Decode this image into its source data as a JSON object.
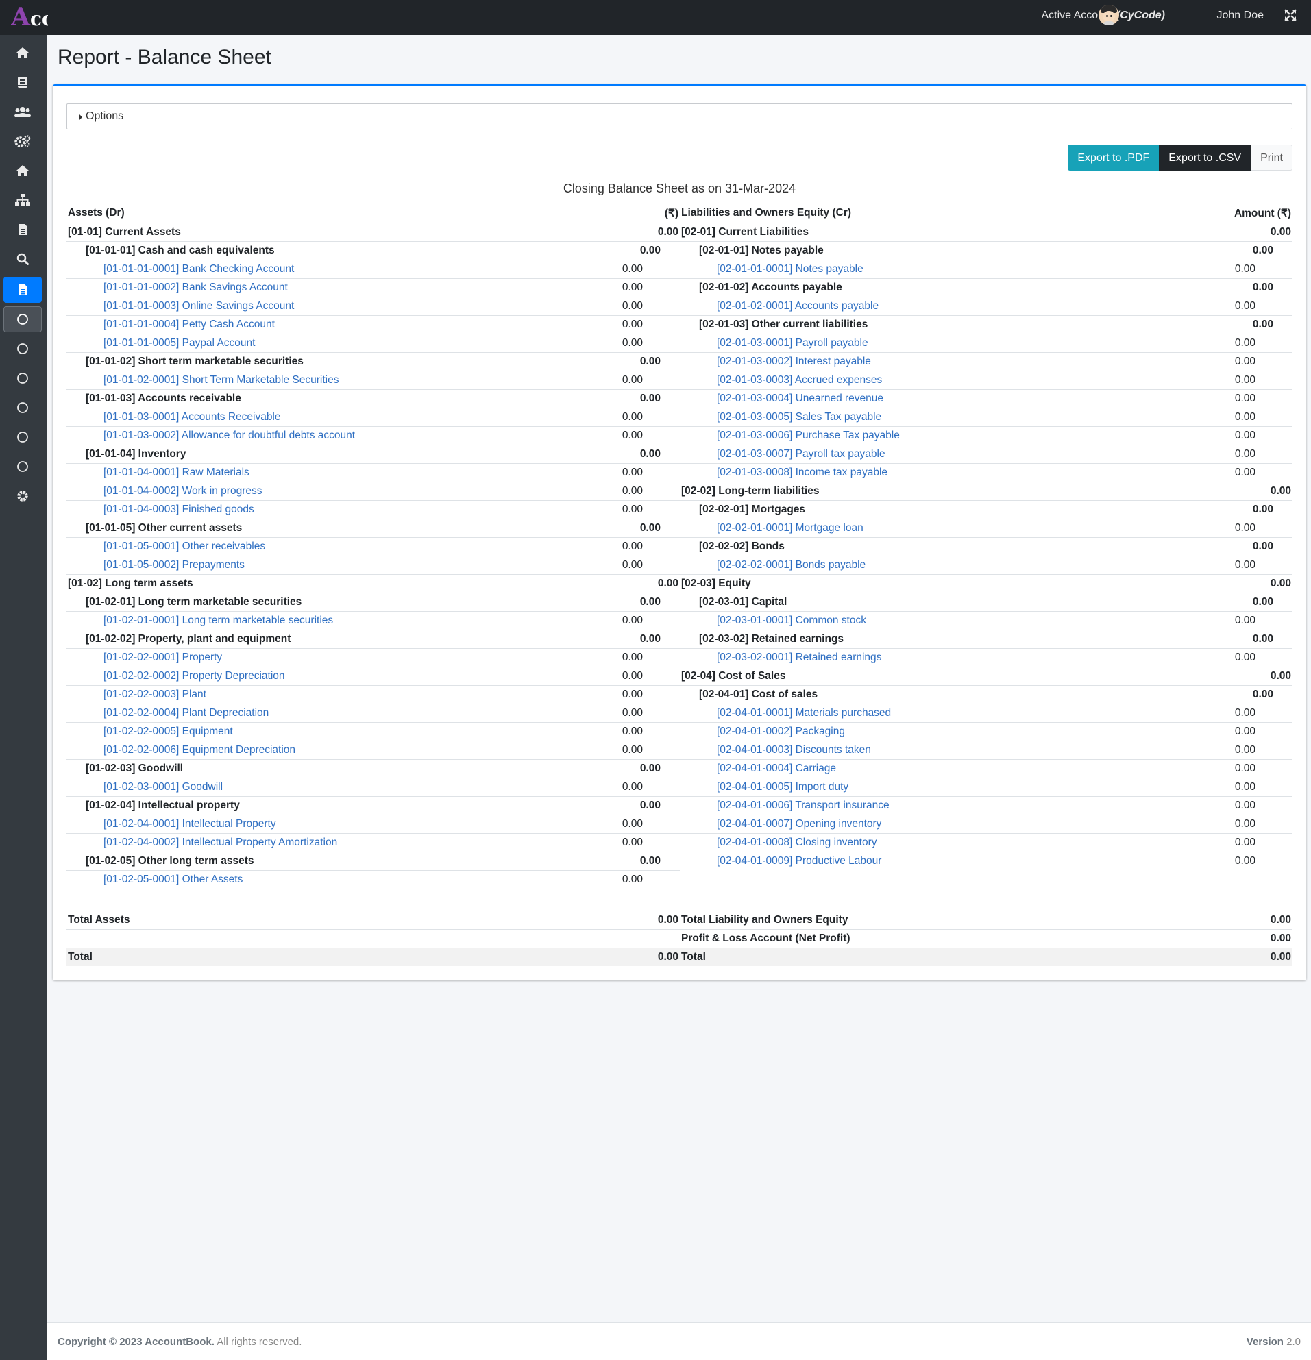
{
  "topbar": {
    "logo_initial": "A",
    "logo_rest": "cc",
    "active_account_label": "Active Account",
    "active_account_code": "(CyCode)",
    "user_name": "John Doe"
  },
  "sidebar": {
    "active_color": "#007bff",
    "items": [
      {
        "icon": "home-icon"
      },
      {
        "icon": "book-icon"
      },
      {
        "icon": "users-icon"
      },
      {
        "icon": "gears-icon"
      },
      {
        "icon": "home-icon"
      },
      {
        "icon": "sitemap-icon"
      },
      {
        "icon": "document-icon"
      },
      {
        "icon": "search-icon"
      },
      {
        "icon": "report-icon",
        "state": "active"
      },
      {
        "icon": "circle-icon",
        "state": "open"
      },
      {
        "icon": "circle-icon"
      },
      {
        "icon": "circle-icon"
      },
      {
        "icon": "circle-icon"
      },
      {
        "icon": "circle-icon"
      },
      {
        "icon": "circle-icon"
      },
      {
        "icon": "gear-icon"
      }
    ]
  },
  "page": {
    "title": "Report - Balance Sheet"
  },
  "options": {
    "label": "Options"
  },
  "buttons": {
    "pdf": "Export to .PDF",
    "csv": "Export to .CSV",
    "print": "Print"
  },
  "report": {
    "title": "Closing Balance Sheet as on 31-Mar-2024",
    "headers": {
      "assets": "Assets (Dr)",
      "assets_amount": "(₹)",
      "liabilities": "Liabilities and Owners Equity (Cr)",
      "liabilities_amount": "Amount (₹)"
    },
    "rows": [
      [
        {
          "name": "[01-01] Current Assets",
          "amount": "0.00",
          "level": 0
        },
        {
          "name": "[02-01] Current Liabilities",
          "amount": "0.00",
          "level": 0
        }
      ],
      [
        {
          "name": "[01-01-01] Cash and cash equivalents",
          "amount": "0.00",
          "level": 1
        },
        {
          "name": "[02-01-01] Notes payable",
          "amount": "0.00",
          "level": 1
        }
      ],
      [
        {
          "name": "[01-01-01-0001] Bank Checking Account",
          "amount": "0.00",
          "level": 2
        },
        {
          "name": "[02-01-01-0001] Notes payable",
          "amount": "0.00",
          "level": 2
        }
      ],
      [
        {
          "name": "[01-01-01-0002] Bank Savings Account",
          "amount": "0.00",
          "level": 2
        },
        {
          "name": "[02-01-02] Accounts payable",
          "amount": "0.00",
          "level": 1
        }
      ],
      [
        {
          "name": "[01-01-01-0003] Online Savings Account",
          "amount": "0.00",
          "level": 2
        },
        {
          "name": "[02-01-02-0001] Accounts payable",
          "amount": "0.00",
          "level": 2
        }
      ],
      [
        {
          "name": "[01-01-01-0004] Petty Cash Account",
          "amount": "0.00",
          "level": 2
        },
        {
          "name": "[02-01-03] Other current liabilities",
          "amount": "0.00",
          "level": 1
        }
      ],
      [
        {
          "name": "[01-01-01-0005] Paypal Account",
          "amount": "0.00",
          "level": 2
        },
        {
          "name": "[02-01-03-0001] Payroll payable",
          "amount": "0.00",
          "level": 2
        }
      ],
      [
        {
          "name": "[01-01-02] Short term marketable securities",
          "amount": "0.00",
          "level": 1
        },
        {
          "name": "[02-01-03-0002] Interest payable",
          "amount": "0.00",
          "level": 2
        }
      ],
      [
        {
          "name": "[01-01-02-0001] Short Term Marketable Securities",
          "amount": "0.00",
          "level": 2
        },
        {
          "name": "[02-01-03-0003] Accrued expenses",
          "amount": "0.00",
          "level": 2
        }
      ],
      [
        {
          "name": "[01-01-03] Accounts receivable",
          "amount": "0.00",
          "level": 1
        },
        {
          "name": "[02-01-03-0004] Unearned revenue",
          "amount": "0.00",
          "level": 2
        }
      ],
      [
        {
          "name": "[01-01-03-0001] Accounts Receivable",
          "amount": "0.00",
          "level": 2
        },
        {
          "name": "[02-01-03-0005] Sales Tax payable",
          "amount": "0.00",
          "level": 2
        }
      ],
      [
        {
          "name": "[01-01-03-0002] Allowance for doubtful debts account",
          "amount": "0.00",
          "level": 2
        },
        {
          "name": "[02-01-03-0006] Purchase Tax payable",
          "amount": "0.00",
          "level": 2
        }
      ],
      [
        {
          "name": "[01-01-04] Inventory",
          "amount": "0.00",
          "level": 1
        },
        {
          "name": "[02-01-03-0007] Payroll tax payable",
          "amount": "0.00",
          "level": 2
        }
      ],
      [
        {
          "name": "[01-01-04-0001] Raw Materials",
          "amount": "0.00",
          "level": 2
        },
        {
          "name": "[02-01-03-0008] Income tax payable",
          "amount": "0.00",
          "level": 2
        }
      ],
      [
        {
          "name": "[01-01-04-0002] Work in progress",
          "amount": "0.00",
          "level": 2
        },
        {
          "name": "[02-02] Long-term liabilities",
          "amount": "0.00",
          "level": 0
        }
      ],
      [
        {
          "name": "[01-01-04-0003] Finished goods",
          "amount": "0.00",
          "level": 2
        },
        {
          "name": "[02-02-01] Mortgages",
          "amount": "0.00",
          "level": 1
        }
      ],
      [
        {
          "name": "[01-01-05] Other current assets",
          "amount": "0.00",
          "level": 1
        },
        {
          "name": "[02-02-01-0001] Mortgage loan",
          "amount": "0.00",
          "level": 2
        }
      ],
      [
        {
          "name": "[01-01-05-0001] Other receivables",
          "amount": "0.00",
          "level": 2
        },
        {
          "name": "[02-02-02] Bonds",
          "amount": "0.00",
          "level": 1
        }
      ],
      [
        {
          "name": "[01-01-05-0002] Prepayments",
          "amount": "0.00",
          "level": 2
        },
        {
          "name": "[02-02-02-0001] Bonds payable",
          "amount": "0.00",
          "level": 2
        }
      ],
      [
        {
          "name": "[01-02] Long term assets",
          "amount": "0.00",
          "level": 0
        },
        {
          "name": "[02-03] Equity",
          "amount": "0.00",
          "level": 0
        }
      ],
      [
        {
          "name": "[01-02-01] Long term marketable securities",
          "amount": "0.00",
          "level": 1
        },
        {
          "name": "[02-03-01] Capital",
          "amount": "0.00",
          "level": 1
        }
      ],
      [
        {
          "name": "[01-02-01-0001] Long term marketable securities",
          "amount": "0.00",
          "level": 2
        },
        {
          "name": "[02-03-01-0001] Common stock",
          "amount": "0.00",
          "level": 2
        }
      ],
      [
        {
          "name": "[01-02-02] Property, plant and equipment",
          "amount": "0.00",
          "level": 1
        },
        {
          "name": "[02-03-02] Retained earnings",
          "amount": "0.00",
          "level": 1
        }
      ],
      [
        {
          "name": "[01-02-02-0001] Property",
          "amount": "0.00",
          "level": 2
        },
        {
          "name": "[02-03-02-0001] Retained earnings",
          "amount": "0.00",
          "level": 2
        }
      ],
      [
        {
          "name": "[01-02-02-0002] Property Depreciation",
          "amount": "0.00",
          "level": 2
        },
        {
          "name": "[02-04] Cost of Sales",
          "amount": "0.00",
          "level": 0
        }
      ],
      [
        {
          "name": "[01-02-02-0003] Plant",
          "amount": "0.00",
          "level": 2
        },
        {
          "name": "[02-04-01] Cost of sales",
          "amount": "0.00",
          "level": 1
        }
      ],
      [
        {
          "name": "[01-02-02-0004] Plant Depreciation",
          "amount": "0.00",
          "level": 2
        },
        {
          "name": "[02-04-01-0001] Materials purchased",
          "amount": "0.00",
          "level": 2
        }
      ],
      [
        {
          "name": "[01-02-02-0005] Equipment",
          "amount": "0.00",
          "level": 2
        },
        {
          "name": "[02-04-01-0002] Packaging",
          "amount": "0.00",
          "level": 2
        }
      ],
      [
        {
          "name": "[01-02-02-0006] Equipment Depreciation",
          "amount": "0.00",
          "level": 2
        },
        {
          "name": "[02-04-01-0003] Discounts taken",
          "amount": "0.00",
          "level": 2
        }
      ],
      [
        {
          "name": "[01-02-03] Goodwill",
          "amount": "0.00",
          "level": 1
        },
        {
          "name": "[02-04-01-0004] Carriage",
          "amount": "0.00",
          "level": 2
        }
      ],
      [
        {
          "name": "[01-02-03-0001] Goodwill",
          "amount": "0.00",
          "level": 2
        },
        {
          "name": "[02-04-01-0005] Import duty",
          "amount": "0.00",
          "level": 2
        }
      ],
      [
        {
          "name": "[01-02-04] Intellectual property",
          "amount": "0.00",
          "level": 1
        },
        {
          "name": "[02-04-01-0006] Transport insurance",
          "amount": "0.00",
          "level": 2
        }
      ],
      [
        {
          "name": "[01-02-04-0001] Intellectual Property",
          "amount": "0.00",
          "level": 2
        },
        {
          "name": "[02-04-01-0007] Opening inventory",
          "amount": "0.00",
          "level": 2
        }
      ],
      [
        {
          "name": "[01-02-04-0002] Intellectual Property Amortization",
          "amount": "0.00",
          "level": 2
        },
        {
          "name": "[02-04-01-0008] Closing inventory",
          "amount": "0.00",
          "level": 2
        }
      ],
      [
        {
          "name": "[01-02-05] Other long term assets",
          "amount": "0.00",
          "level": 1
        },
        {
          "name": "[02-04-01-0009] Productive Labour",
          "amount": "0.00",
          "level": 2
        }
      ],
      [
        {
          "name": "[01-02-05-0001] Other Assets",
          "amount": "0.00",
          "level": 2
        },
        null
      ]
    ],
    "totals": [
      {
        "left_label": "Total Assets",
        "left_amount": "0.00",
        "right_label": "Total Liability and Owners Equity",
        "right_amount": "0.00"
      },
      {
        "left_label": "",
        "left_amount": "",
        "right_label": "Profit & Loss Account (Net Profit)",
        "right_amount": "0.00"
      },
      {
        "left_label": "Total",
        "left_amount": "0.00",
        "right_label": "Total",
        "right_amount": "0.00"
      }
    ]
  },
  "footer": {
    "copyright_prefix": "Copyright © 2023 AccountBook.",
    "copyright_suffix": " All rights reserved.",
    "version_label": "Version",
    "version_value": " 2.0"
  }
}
